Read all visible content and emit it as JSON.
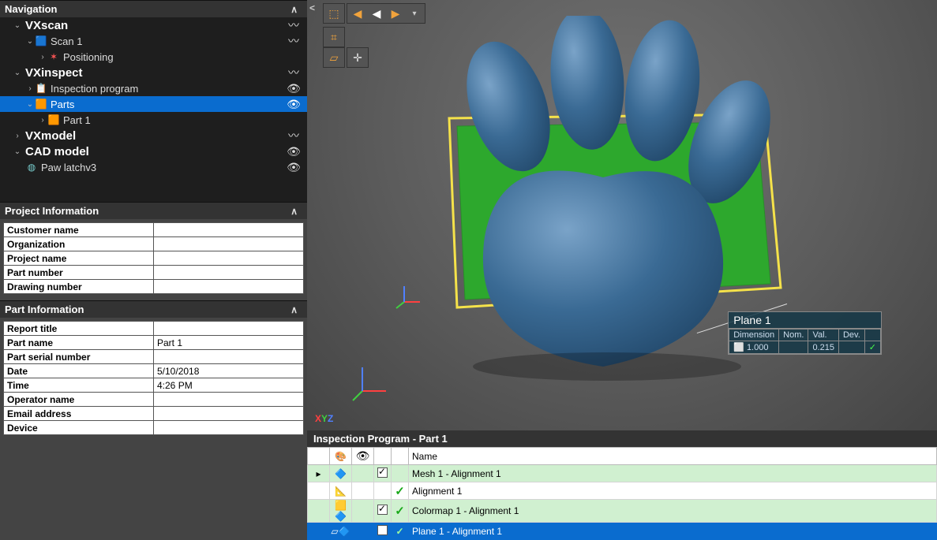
{
  "nav": {
    "title": "Navigation",
    "vxscan": {
      "label": "VXscan"
    },
    "scan1": {
      "label": "Scan 1"
    },
    "positioning": {
      "label": "Positioning"
    },
    "vxinspect": {
      "label": "VXinspect"
    },
    "inspprog": {
      "label": "Inspection program"
    },
    "parts": {
      "label": "Parts"
    },
    "part1": {
      "label": "Part 1"
    },
    "vxmodel": {
      "label": "VXmodel"
    },
    "cadmodel": {
      "label": "CAD model"
    },
    "paw": {
      "label": "Paw latchv3"
    }
  },
  "project": {
    "header": "Project Information",
    "customer": {
      "k": "Customer name",
      "v": ""
    },
    "org": {
      "k": "Organization",
      "v": ""
    },
    "proj": {
      "k": "Project name",
      "v": ""
    },
    "partno": {
      "k": "Part number",
      "v": ""
    },
    "draw": {
      "k": "Drawing number",
      "v": ""
    }
  },
  "part": {
    "header": "Part Information",
    "report": {
      "k": "Report title",
      "v": ""
    },
    "pname": {
      "k": "Part name",
      "v": "Part 1"
    },
    "serial": {
      "k": "Part serial number",
      "v": ""
    },
    "date": {
      "k": "Date",
      "v": "5/10/2018"
    },
    "time": {
      "k": "Time",
      "v": "4:26 PM"
    },
    "op": {
      "k": "Operator name",
      "v": ""
    },
    "email": {
      "k": "Email address",
      "v": ""
    },
    "device": {
      "k": "Device",
      "v": ""
    }
  },
  "viewport": {
    "xyz": {
      "x": "X",
      "y": "Y",
      "z": "Z"
    },
    "annotation": {
      "title": "Plane 1",
      "h_dim": "Dimension",
      "h_nom": "Nom.",
      "h_val": "Val.",
      "h_dev": "Dev.",
      "dim": "⬜ 1.000",
      "nom": "",
      "val": "0.215",
      "dev": ""
    }
  },
  "grid": {
    "header": "Inspection Program - Part 1",
    "col_name": "Name",
    "rows": [
      {
        "name": "Mesh 1 - Alignment 1"
      },
      {
        "name": "Alignment 1"
      },
      {
        "name": "Colormap 1 - Alignment 1"
      },
      {
        "name": "Plane 1 - Alignment 1"
      }
    ]
  }
}
